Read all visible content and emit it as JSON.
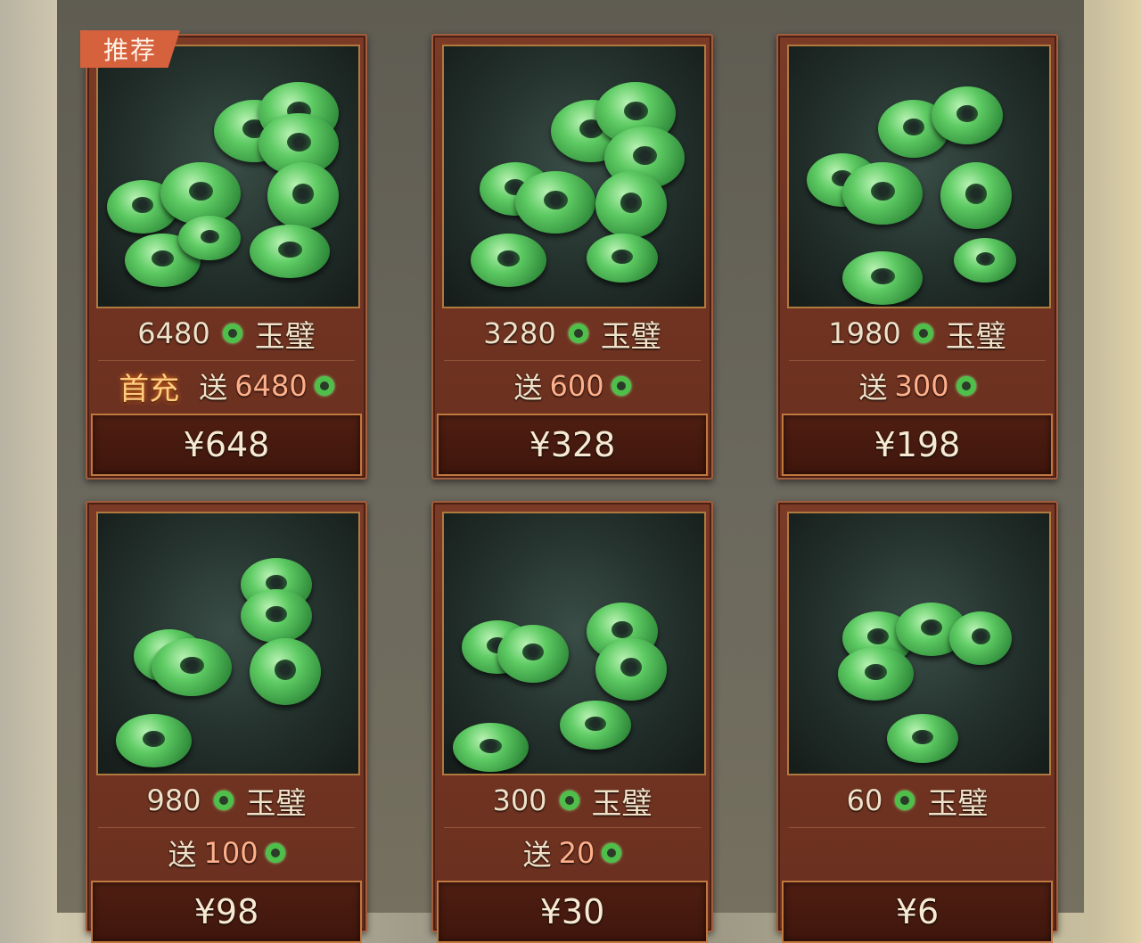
{
  "badge": "推荐",
  "currency_name": "玉璧",
  "gift_label": "送",
  "first_recharge_label": "首充",
  "packs": [
    {
      "amount": "6480",
      "bonus": "6480",
      "price": "¥648"
    },
    {
      "amount": "3280",
      "bonus": "600",
      "price": "¥328"
    },
    {
      "amount": "1980",
      "bonus": "300",
      "price": "¥198"
    },
    {
      "amount": "980",
      "bonus": "100",
      "price": "¥98"
    },
    {
      "amount": "300",
      "bonus": "20",
      "price": "¥30"
    },
    {
      "amount": "60",
      "bonus": "",
      "price": "¥6"
    }
  ],
  "icons": {
    "currency": "jade-ring-icon"
  },
  "colors": {
    "card": "#6a2f1f",
    "jade": "#4ec04a",
    "badge": "#d6613d"
  }
}
